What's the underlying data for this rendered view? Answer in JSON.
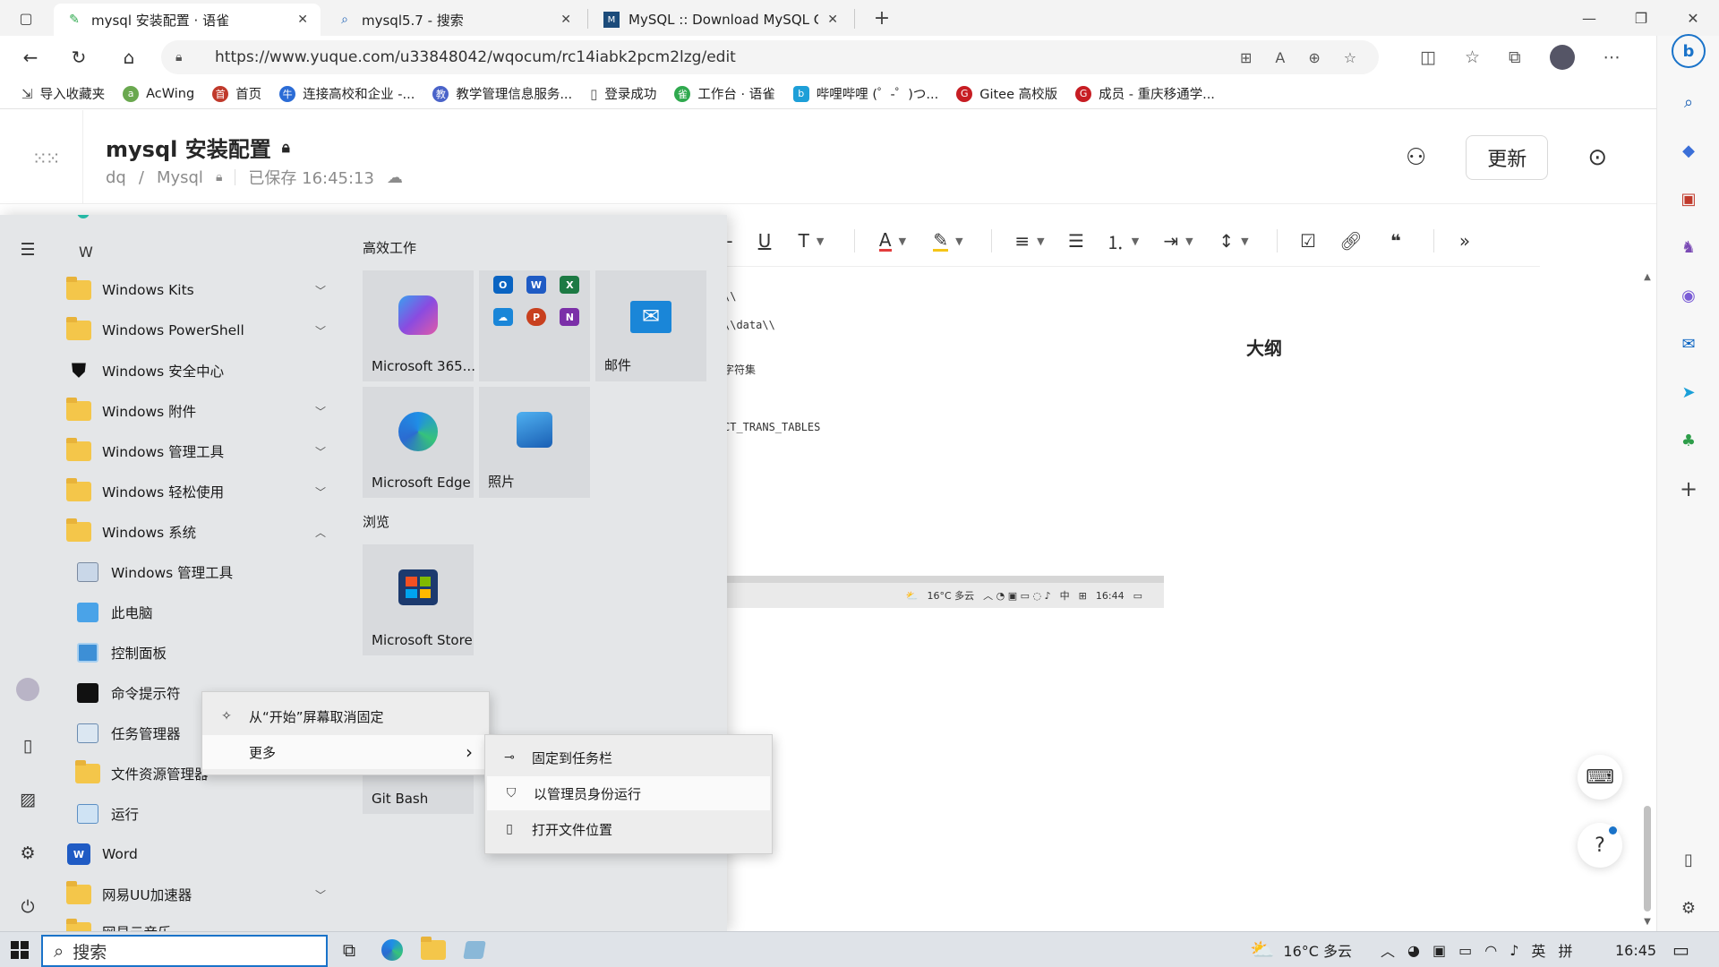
{
  "browser": {
    "tabs": [
      {
        "title": "mysql 安装配置 · 语雀",
        "icon": "yuque-icon",
        "active": true
      },
      {
        "title": "mysql5.7 - 搜索",
        "icon": "search-icon",
        "active": false
      },
      {
        "title": "MySQL :: Download MySQL Com",
        "icon": "mysql-icon",
        "active": false
      }
    ],
    "new_tab": "+",
    "url": "https://www.yuque.com/u33848042/wqocum/rc14iabk2pcm2lzg/edit",
    "favorites": [
      {
        "label": "导入收藏夹",
        "icon": "import-icon",
        "color": "#555555"
      },
      {
        "label": "AcWing",
        "icon": "acwing-icon",
        "color": "#6aa84f"
      },
      {
        "label": "首页",
        "icon": "home-fav-icon",
        "color": "#c0392b"
      },
      {
        "label": "连接高校和企业 -...",
        "icon": "niuke-icon",
        "color": "#2b6cd6"
      },
      {
        "label": "教学管理信息服务...",
        "icon": "edu-icon",
        "color": "#4a63c9"
      },
      {
        "label": "登录成功",
        "icon": "page-icon",
        "color": "#777777"
      },
      {
        "label": "工作台 · 语雀",
        "icon": "yuque-fav-icon",
        "color": "#2fa94e"
      },
      {
        "label": "哔哩哔哩 (゜-゜)つ...",
        "icon": "bilibili-icon",
        "color": "#1e9fd8"
      },
      {
        "label": "Gitee 高校版",
        "icon": "gitee-icon",
        "color": "#c71d23"
      },
      {
        "label": "成员 - 重庆移通学...",
        "icon": "gitee-icon",
        "color": "#c71d23"
      }
    ]
  },
  "yuque": {
    "title": "mysql 安装配置",
    "crumb_user": "dq",
    "crumb_sep": "/",
    "crumb_book": "Mysql",
    "saved": "已保存 16:45:13",
    "update_button": "更新",
    "doc_fragments": [
      "\\\\",
      "\\\\data\\\\",
      "字符集",
      "CT_TRANS_TABLES"
    ],
    "outline_title": "大纲",
    "embed_strip": {
      "weather": "16°C 多云",
      "ime": "中",
      "time": "16:44"
    }
  },
  "start_menu": {
    "letter": "W",
    "apps": [
      {
        "label": "Windows Kits",
        "type": "folder",
        "expand": "﹀"
      },
      {
        "label": "Windows PowerShell",
        "type": "folder",
        "expand": "﹀"
      },
      {
        "label": "Windows 安全中心",
        "type": "shield",
        "expand": ""
      },
      {
        "label": "Windows 附件",
        "type": "folder",
        "expand": "﹀"
      },
      {
        "label": "Windows 管理工具",
        "type": "folder",
        "expand": "﹀"
      },
      {
        "label": "Windows 轻松使用",
        "type": "folder",
        "expand": "﹀"
      },
      {
        "label": "Windows 系统",
        "type": "folder",
        "expand": "︿"
      },
      {
        "label": "Windows 管理工具",
        "type": "sub-admin",
        "expand": ""
      },
      {
        "label": "此电脑",
        "type": "sub-pc",
        "expand": ""
      },
      {
        "label": "控制面板",
        "type": "sub-control",
        "expand": ""
      },
      {
        "label": "命令提示符",
        "type": "sub-cmd",
        "expand": ""
      },
      {
        "label": "任务管理器",
        "type": "sub-task",
        "expand": ""
      },
      {
        "label": "文件资源管理器",
        "type": "sub-explorer",
        "expand": ""
      },
      {
        "label": "运行",
        "type": "sub-run",
        "expand": ""
      },
      {
        "label": "Word",
        "type": "word",
        "expand": ""
      },
      {
        "label": "网易UU加速器",
        "type": "folder",
        "expand": "﹀"
      },
      {
        "label": "网易云音乐",
        "type": "folder",
        "expand": ""
      }
    ],
    "groups": [
      {
        "title": "高效工作"
      },
      {
        "title": "浏览"
      }
    ],
    "tiles": {
      "m365": "Microsoft 365...",
      "mail": "邮件",
      "edge": "Microsoft Edge",
      "photos": "照片",
      "store": "Microsoft Store",
      "gitbash": "Git Bash"
    },
    "office_minis": [
      {
        "letter": "O",
        "color": "#0a64c2",
        "name": "outlook-mini-icon"
      },
      {
        "letter": "W",
        "color": "#1f5bc4",
        "name": "word-mini-icon"
      },
      {
        "letter": "X",
        "color": "#1d7a44",
        "name": "excel-mini-icon"
      },
      {
        "letter": "☁",
        "color": "#1a86d8",
        "name": "onedrive-mini-icon"
      },
      {
        "letter": "P",
        "color": "#c8401f",
        "name": "powerpoint-mini-icon"
      },
      {
        "letter": "N",
        "color": "#7b2fa8",
        "name": "onenote-mini-icon"
      }
    ]
  },
  "context_menu": {
    "items": [
      {
        "label": "从“开始”屏幕取消固定",
        "icon": "unpin-icon"
      },
      {
        "label": "更多",
        "icon": "",
        "arrow": "›"
      }
    ]
  },
  "submenu": {
    "items": [
      {
        "label": "固定到任务栏",
        "icon": "pin-icon",
        "highlight": false
      },
      {
        "label": "以管理员身份运行",
        "icon": "admin-run-icon",
        "highlight": true
      },
      {
        "label": "打开文件位置",
        "icon": "file-location-icon",
        "highlight": false
      }
    ]
  },
  "taskbar": {
    "search_placeholder": "搜索",
    "weather": "16°C 多云",
    "ime": "英",
    "ime_mode": "拼",
    "time": "16:45"
  },
  "colors": {
    "accent": "#1a73c9",
    "start_bg": "#e4e6e8",
    "tile_bg": "#d8dadd"
  }
}
